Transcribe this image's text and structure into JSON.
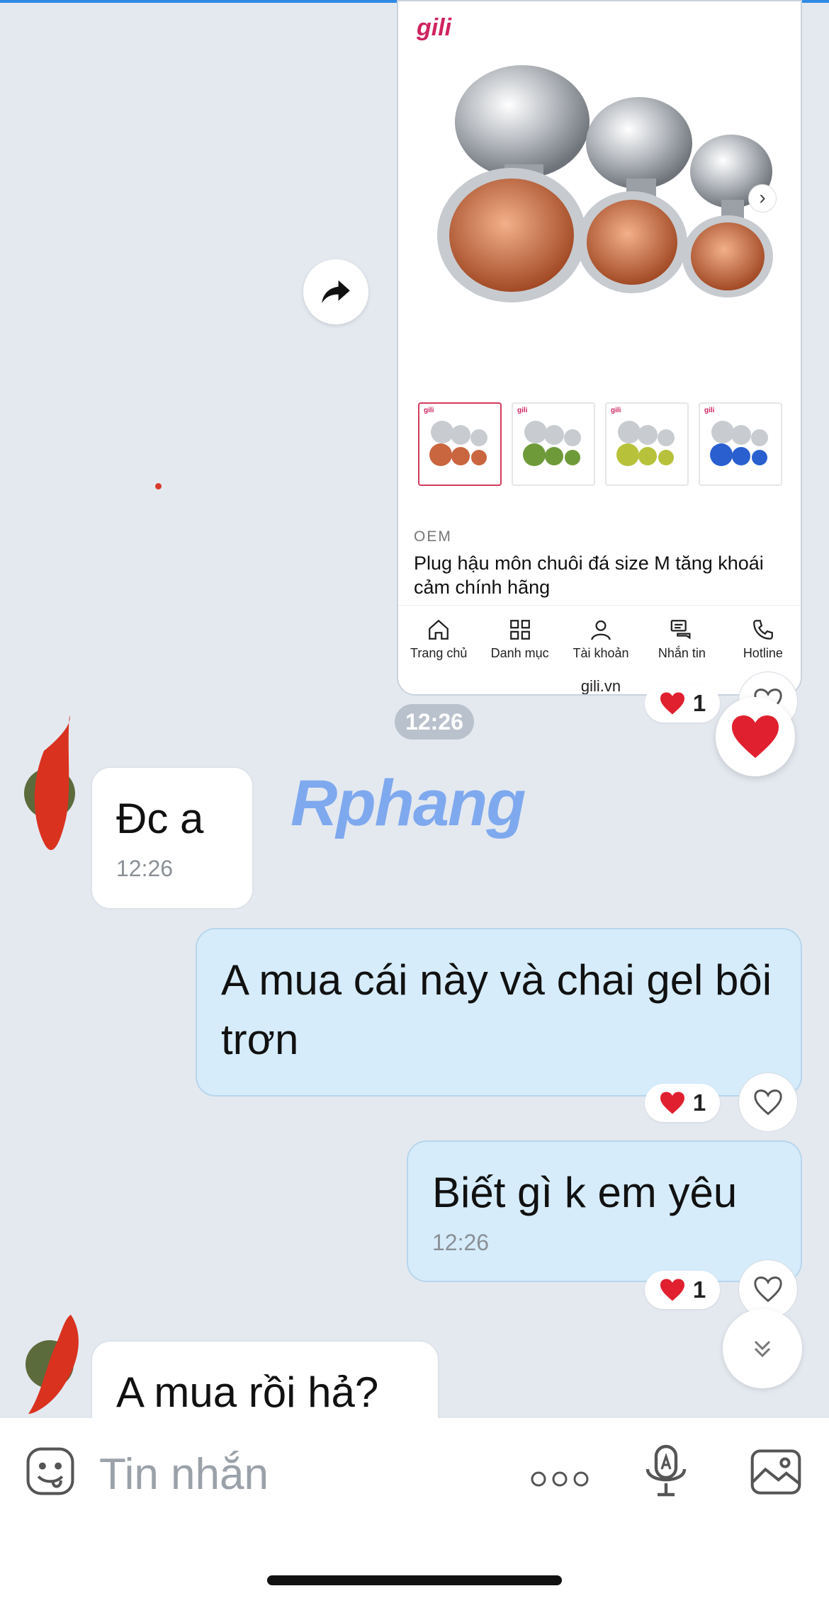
{
  "shared_card": {
    "logo": "gili",
    "thumb_logo": "gili",
    "brand": "OEM",
    "product_title": "Plug hậu môn chuôi đá size M tăng khoái cảm chính hãng",
    "thumbnail_colors": [
      "#c9653f",
      "#6f9a3a",
      "#b7c23a",
      "#2a5fd0"
    ],
    "nav": [
      {
        "label": "Trang chủ",
        "icon": "home-icon"
      },
      {
        "label": "Danh mục",
        "icon": "grid-icon"
      },
      {
        "label": "Tài khoản",
        "icon": "user-icon"
      },
      {
        "label": "Nhắn tin",
        "icon": "chat-icon"
      },
      {
        "label": "Hotline",
        "icon": "phone-icon"
      }
    ],
    "domain": "gili.vn"
  },
  "time_separator": "12:26",
  "watermark": "Rphang",
  "messages": [
    {
      "direction": "in",
      "text": "Đc a",
      "time": "12:26"
    },
    {
      "direction": "out",
      "text": "A mua cái này và chai gel bôi trơn",
      "reaction_count": "1"
    },
    {
      "direction": "out",
      "text": "Biết gì k em yêu",
      "time": "12:26",
      "reaction_count": "1"
    },
    {
      "direction": "in",
      "text": "A mua rồi hả?"
    }
  ],
  "card_reaction_count": "1",
  "composer": {
    "placeholder": "Tin nhắn"
  },
  "colors": {
    "accent": "#2f8ae5",
    "outgoing_bubble": "#d6ecfb",
    "heart": "#e0202f",
    "background": "#e4e9f0"
  }
}
